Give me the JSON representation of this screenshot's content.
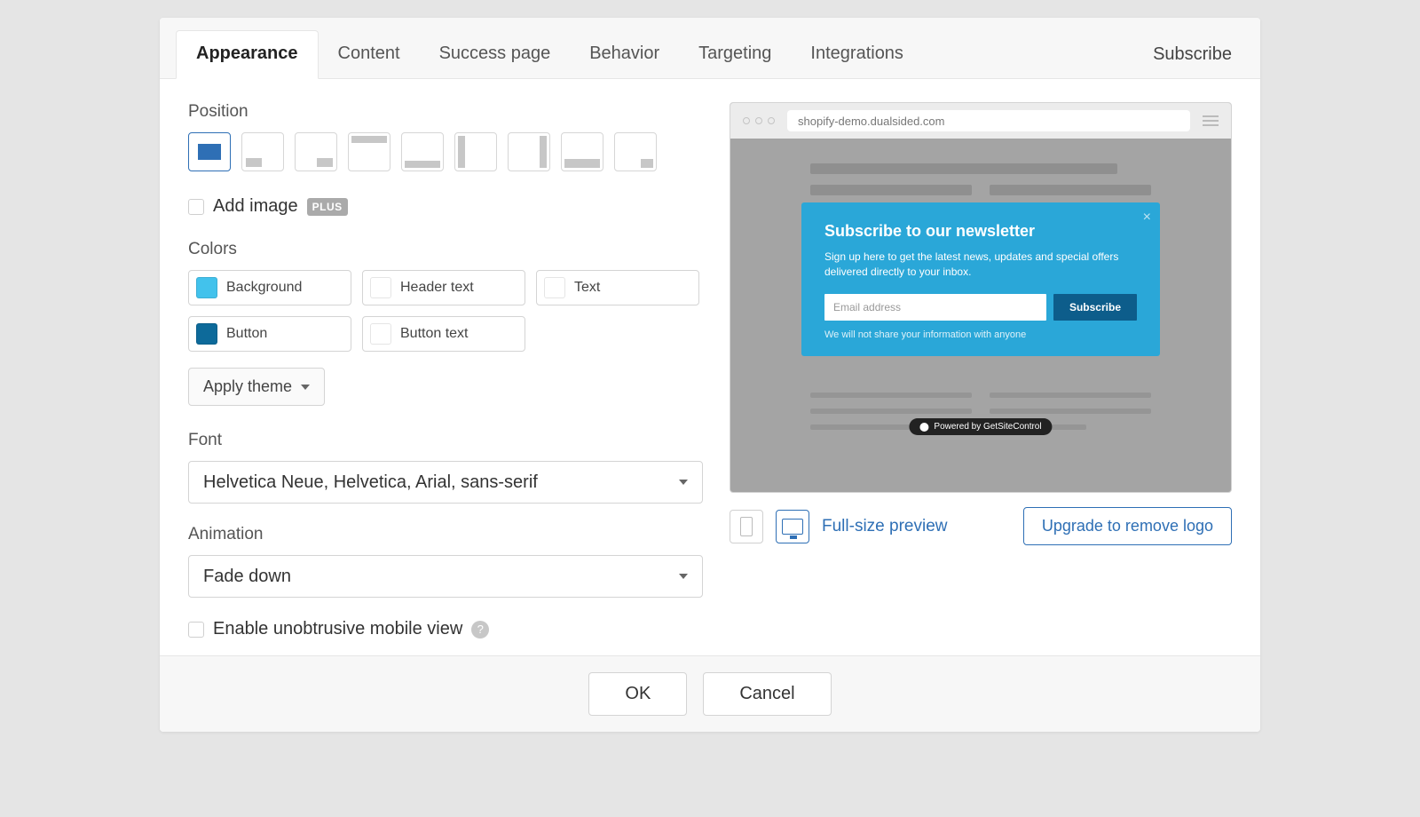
{
  "tabs": [
    "Appearance",
    "Content",
    "Success page",
    "Behavior",
    "Targeting",
    "Integrations"
  ],
  "active_tab": 0,
  "widget_type": "Subscribe",
  "sections": {
    "position_label": "Position",
    "add_image_label": "Add image",
    "plus_badge": "PLUS",
    "colors_label": "Colors",
    "apply_theme_label": "Apply theme",
    "font_label": "Font",
    "animation_label": "Animation",
    "mobile_view_label": "Enable unobtrusive mobile view"
  },
  "colors": {
    "background": {
      "label": "Background",
      "value": "#42c2ec"
    },
    "header_text": {
      "label": "Header text",
      "value": "#ffffff"
    },
    "text": {
      "label": "Text",
      "value": "#ffffff"
    },
    "button": {
      "label": "Button",
      "value": "#0d6a9a"
    },
    "button_text": {
      "label": "Button text",
      "value": "#ffffff"
    }
  },
  "font": {
    "value": "Helvetica Neue, Helvetica, Arial, sans-serif"
  },
  "animation": {
    "value": "Fade down"
  },
  "preview": {
    "url": "shopify-demo.dualsided.com",
    "popup_title": "Subscribe to our newsletter",
    "popup_desc": "Sign up here to get the latest news, updates and special offers delivered directly to your inbox.",
    "email_placeholder": "Email address",
    "subscribe_button": "Subscribe",
    "privacy_note": "We will not share your information with anyone",
    "powered_by": "Powered by GetSiteControl"
  },
  "controls": {
    "full_size": "Full-size preview",
    "upgrade": "Upgrade to remove logo"
  },
  "footer": {
    "ok": "OK",
    "cancel": "Cancel"
  }
}
